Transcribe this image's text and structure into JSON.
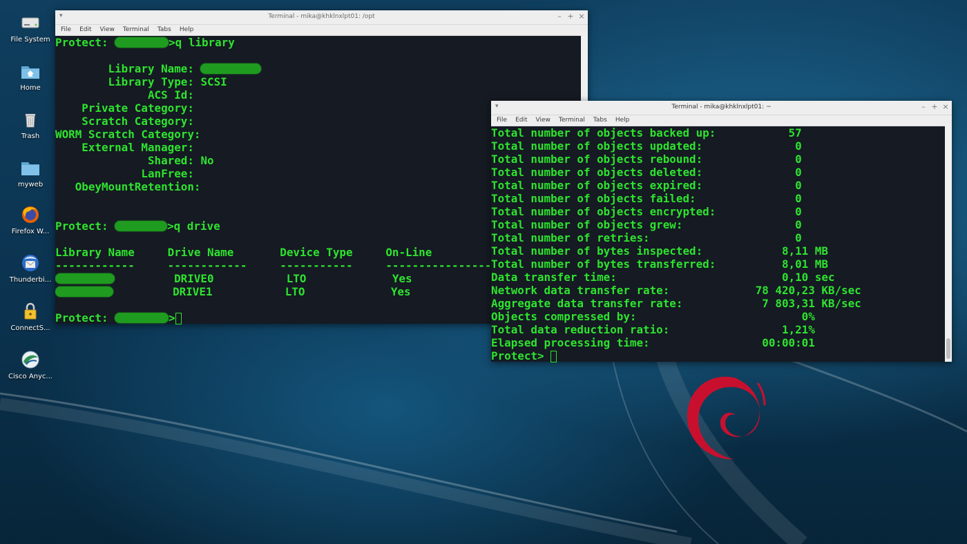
{
  "desktop": {
    "icons": [
      {
        "label": "File System",
        "icon": "drive-icon"
      },
      {
        "label": "Home",
        "icon": "home-folder-icon"
      },
      {
        "label": "Trash",
        "icon": "trash-icon"
      },
      {
        "label": "myweb",
        "icon": "folder-icon"
      },
      {
        "label": "Firefox W...",
        "icon": "firefox-icon"
      },
      {
        "label": "Thunderbi...",
        "icon": "thunderbird-icon"
      },
      {
        "label": "ConnectS...",
        "icon": "lock-icon"
      },
      {
        "label": "Cisco Anyc...",
        "icon": "globe-icon"
      }
    ],
    "colors": {
      "accent_green": "#2ee32e",
      "debian_red": "#c8102e"
    }
  },
  "win1": {
    "title": "Terminal - mika@khklnxlpt01: /opt",
    "menu": [
      "File",
      "Edit",
      "View",
      "Terminal",
      "Tabs",
      "Help"
    ],
    "lines": [
      {
        "pre": "Protect: ",
        "redact_w": 78,
        "post": ">q library"
      },
      {
        "text": ""
      },
      {
        "text": "        Library Name: ",
        "redact_w": 88
      },
      {
        "text": "        Library Type: SCSI"
      },
      {
        "text": "              ACS Id:"
      },
      {
        "text": "    Private Category:"
      },
      {
        "text": "    Scratch Category:"
      },
      {
        "text": "WORM Scratch Category:"
      },
      {
        "text": "    External Manager:"
      },
      {
        "text": "              Shared: No"
      },
      {
        "text": "             LanFree:"
      },
      {
        "text": "   ObeyMountRetention:"
      },
      {
        "text": ""
      },
      {
        "text": ""
      },
      {
        "pre": "Protect: ",
        "redact_w": 76,
        "post": ">q drive"
      },
      {
        "text": ""
      },
      {
        "text": "Library Name     Drive Name       Device Type     On-Line"
      },
      {
        "text": "------------     ------------     -----------     -------------------"
      },
      {
        "redact_w": 86,
        "post": "         DRIVE0           LTO             Yes"
      },
      {
        "redact_w": 84,
        "post": "         DRIVE1           LTO             Yes"
      },
      {
        "text": ""
      },
      {
        "pre": "Protect: ",
        "redact_w": 78,
        "post": ">",
        "cursor": true
      }
    ]
  },
  "win2": {
    "title": "Terminal - mika@khklnxlpt01: ~",
    "menu": [
      "File",
      "Edit",
      "View",
      "Terminal",
      "Tabs",
      "Help"
    ],
    "lines": [
      {
        "text": "Total number of objects backed up:           57"
      },
      {
        "text": "Total number of objects updated:              0"
      },
      {
        "text": "Total number of objects rebound:              0"
      },
      {
        "text": "Total number of objects deleted:              0"
      },
      {
        "text": "Total number of objects expired:              0"
      },
      {
        "text": "Total number of objects failed:               0"
      },
      {
        "text": "Total number of objects encrypted:            0"
      },
      {
        "text": "Total number of objects grew:                 0"
      },
      {
        "text": "Total number of retries:                      0"
      },
      {
        "text": "Total number of bytes inspected:            8,11 MB"
      },
      {
        "text": "Total number of bytes transferred:          8,01 MB"
      },
      {
        "text": "Data transfer time:                         0,10 sec"
      },
      {
        "text": "Network data transfer rate:             78 420,23 KB/sec"
      },
      {
        "text": "Aggregate data transfer rate:            7 803,31 KB/sec"
      },
      {
        "text": "Objects compressed by:                         0%"
      },
      {
        "text": "Total data reduction ratio:                 1,21%"
      },
      {
        "text": "Elapsed processing time:                 00:00:01"
      },
      {
        "pre": "Protect> ",
        "cursor": true
      }
    ]
  }
}
